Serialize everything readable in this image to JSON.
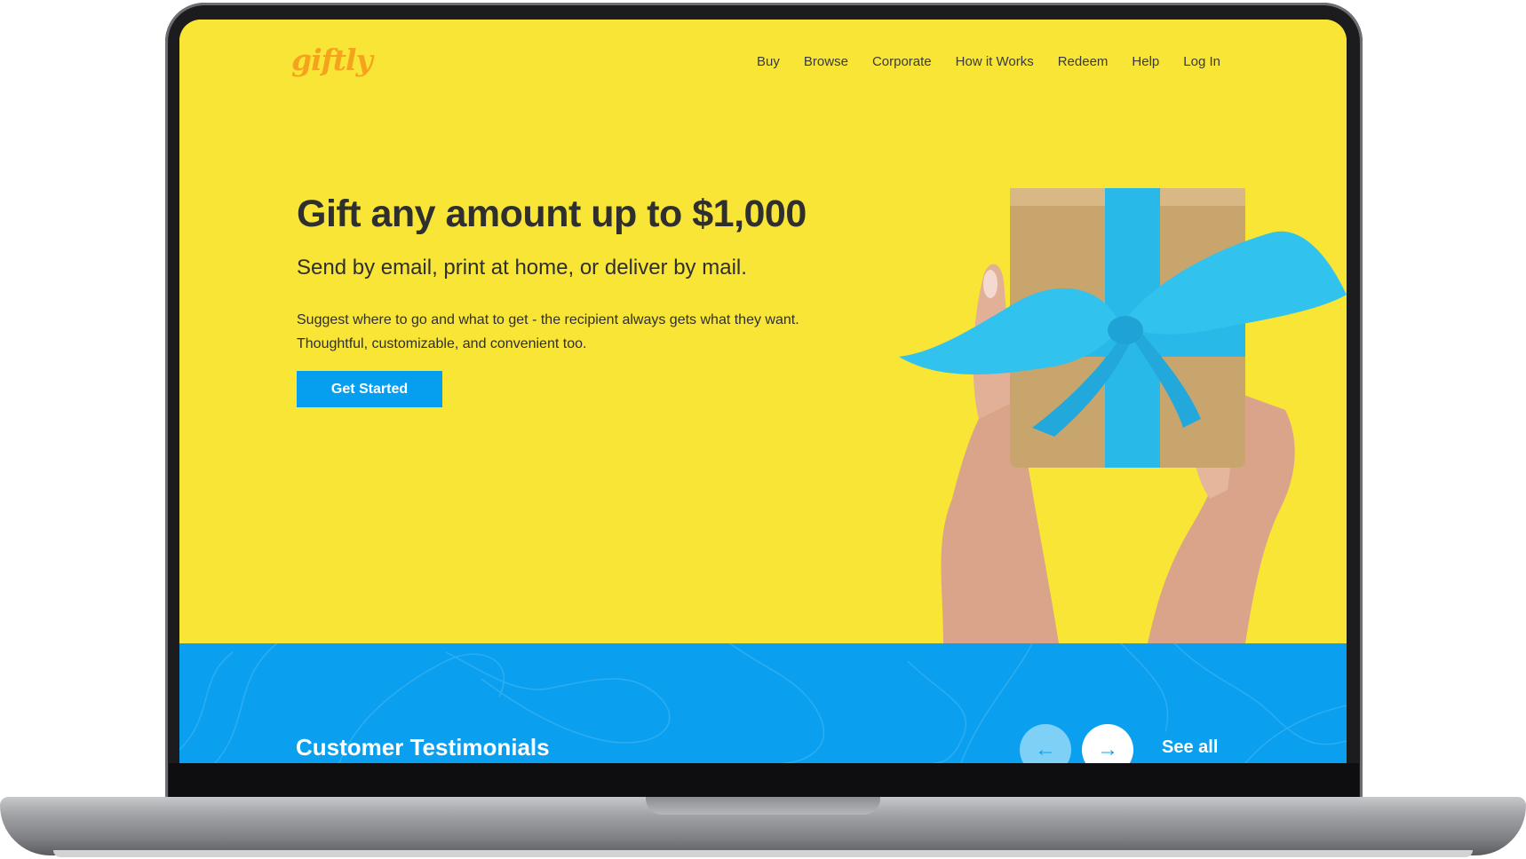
{
  "brand": {
    "logo_text": "giftly"
  },
  "nav": {
    "items": [
      {
        "label": "Buy",
        "name": "nav-buy"
      },
      {
        "label": "Browse",
        "name": "nav-browse"
      },
      {
        "label": "Corporate",
        "name": "nav-corporate"
      },
      {
        "label": "How it Works",
        "name": "nav-how-it-works"
      },
      {
        "label": "Redeem",
        "name": "nav-redeem"
      },
      {
        "label": "Help",
        "name": "nav-help"
      },
      {
        "label": "Log In",
        "name": "nav-log-in"
      }
    ]
  },
  "hero": {
    "headline": "Gift any amount up to $1,000",
    "subheadline": "Send by email, print at home, or deliver by mail.",
    "description_line1": "Suggest where to go and what to get - the recipient always gets what they want.",
    "description_line2": "Thoughtful, customizable, and convenient too.",
    "cta_label": "Get Started"
  },
  "testimonials": {
    "title": "Customer Testimonials",
    "prev_icon": "arrow-left-icon",
    "next_icon": "arrow-right-icon",
    "see_all_label": "See all"
  },
  "colors": {
    "hero_background": "#f8e535",
    "logo": "#f5a31d",
    "accent_blue": "#069ff0",
    "testimonial_background": "#0aa0ef",
    "ribbon": "#29b9e8",
    "gift_box": "#c9a56e"
  }
}
